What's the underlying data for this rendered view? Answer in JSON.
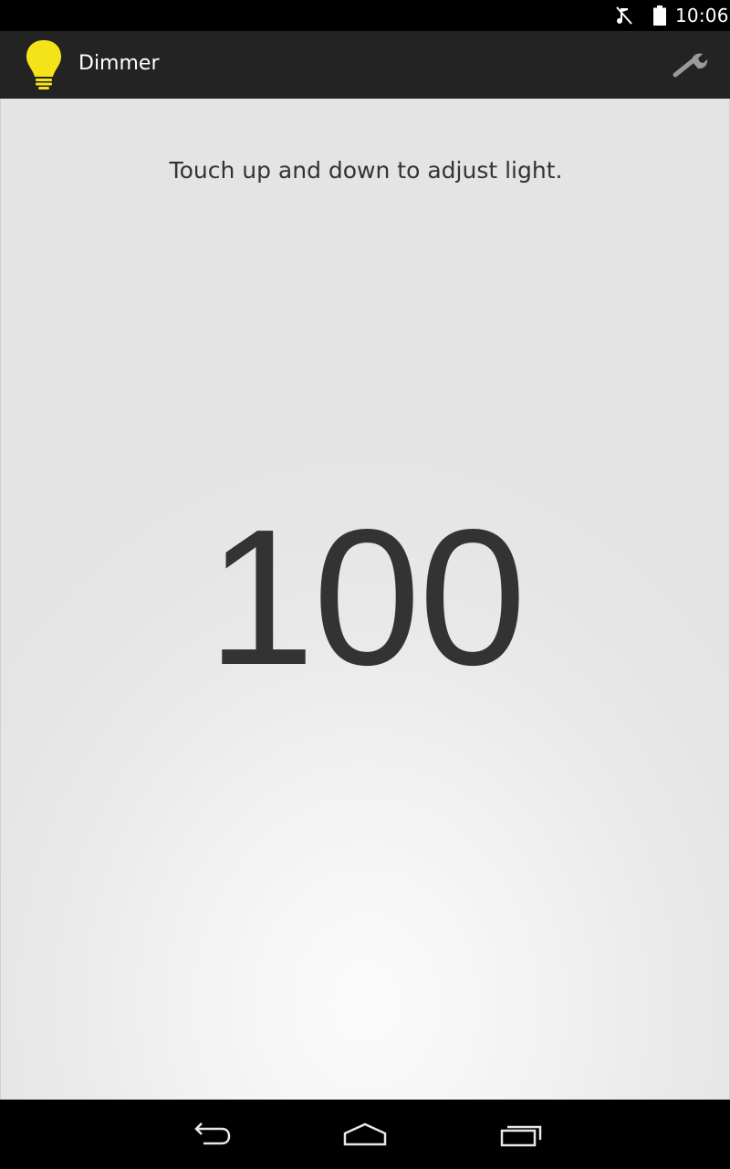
{
  "status_bar": {
    "time": "10:06",
    "icons": [
      "mute-icon",
      "battery-icon"
    ]
  },
  "action_bar": {
    "title": "Dimmer",
    "app_icon": "lightbulb-icon",
    "settings_icon": "wrench-icon",
    "icon_color": "#f5e31a"
  },
  "main": {
    "instruction": "Touch up and down to adjust light.",
    "level": "100"
  },
  "nav_bar": {
    "buttons": [
      "back-icon",
      "home-icon",
      "recents-icon"
    ]
  }
}
